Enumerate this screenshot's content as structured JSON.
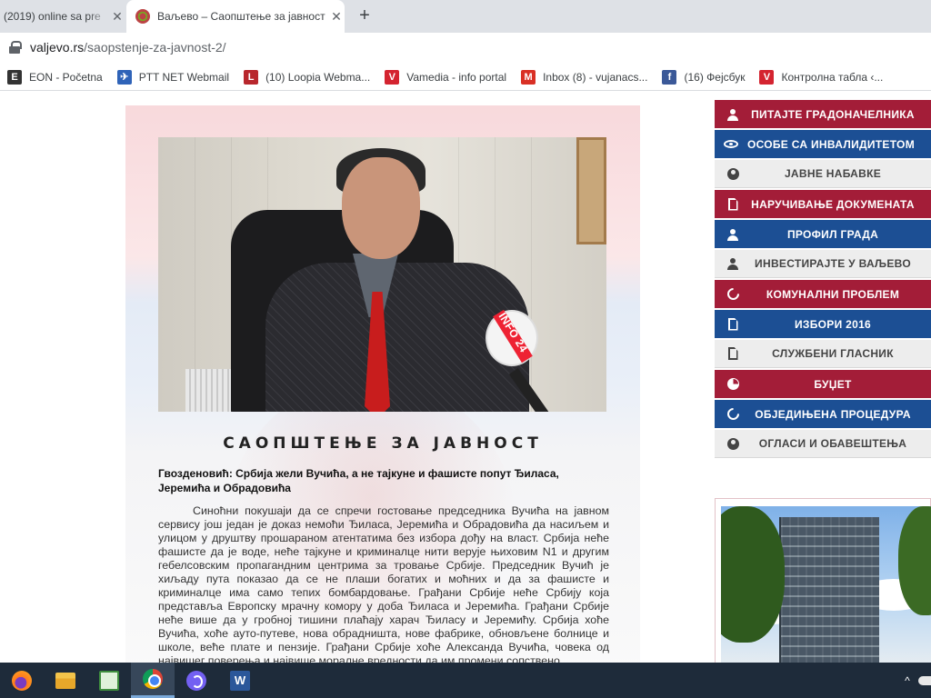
{
  "browser": {
    "tabs": [
      {
        "title": "(2019) online sa pre",
        "close": "✕",
        "active": false
      },
      {
        "title": "Ваљево – Саопштење за јавност",
        "close": "✕",
        "active": true
      }
    ],
    "new_tab": "+",
    "url_host": "valjevo.rs",
    "url_path": "/saopstenje-za-javnost-2/",
    "bookmarks": [
      {
        "label": "EON - Početna",
        "icon": "eon-icon",
        "color": "#333333"
      },
      {
        "label": "PTT NET Webmail",
        "icon": "ptt-icon",
        "color": "#2f63b8"
      },
      {
        "label": "(10) Loopia Webma...",
        "icon": "loopia-icon",
        "color": "#b8272d"
      },
      {
        "label": "Vamedia - info portal",
        "icon": "vamedia-icon",
        "color": "#d42430"
      },
      {
        "label": "Inbox (8) - vujanacs...",
        "icon": "gmail-icon",
        "color": "#d93025"
      },
      {
        "label": "(16) Фејсбук",
        "icon": "facebook-icon",
        "color": "#3b5998"
      },
      {
        "label": "Контролна табла ‹...",
        "icon": "vamedia-icon",
        "color": "#d42430"
      }
    ]
  },
  "article": {
    "title": "САОПШТЕЊЕ ЗА ЈАВНОСТ",
    "subtitle": "Гвозденовић: Србија жели Вучића, а не тајкуне и фашисте попут Ђиласа, Јеремића и Обрадовића",
    "body": "Синоћни покушаји да се спречи гостовање председника Вучића на јавном сервису још један је доказ немоћи Ђиласа, Јеремића и Обрадовића да насиљем и улицом у друштву прошараном атентатима без избора дођу на власт. Србија неће фашисте да је воде, неће тајкуне и криминалце нити верује њиховим N1 и другим гебелсовским пропагандним центрима за тровање Србије. Председник Вучић је хиљаду пута показао да се не плаши богатих и моћних и да за фашисте и криминалце има само тепих бомбардовање. Грађани Србије неће Србију која представља Европску мрачну комору у доба Ђиласа и Јеремића. Грађани Србије неће више да у гробној тишини плаћају харач Ђиласу и Јеремићу. Србија хоће Вучића, хоће ауто-путеве, нова обрадништа, нове фабрике, обновљене болнице и школе, веће плате и пензије. Грађани Србије хоће Александа Вучића, човека од највишег поверења и највише моралне вредности да им промени сопствено"
  },
  "sidebar": {
    "buttons": [
      {
        "label": "ПИТАЈТЕ ГРАДОНАЧЕЛНИКА",
        "style": "red",
        "icon": "person-icon"
      },
      {
        "label": "ОСОБЕ СА ИНВАЛИДИТЕТОМ",
        "style": "blue",
        "icon": "eye-icon"
      },
      {
        "label": "ЈАВНЕ НАБАВКЕ",
        "style": "grey",
        "icon": "globe-icon"
      },
      {
        "label": "НАРУЧИВАЊЕ ДОКУМЕНАТА",
        "style": "red",
        "icon": "document-icon"
      },
      {
        "label": "ПРОФИЛ ГРАДА",
        "style": "blue",
        "icon": "person-icon"
      },
      {
        "label": "ИНВЕСТИРАЈТЕ У ВАЉЕВО",
        "style": "grey",
        "icon": "person-icon"
      },
      {
        "label": "КОМУНАЛНИ ПРОБЛЕМ",
        "style": "red",
        "icon": "refresh-icon"
      },
      {
        "label": "ИЗБОРИ 2016",
        "style": "blue",
        "icon": "document-icon"
      },
      {
        "label": "СЛУЖБЕНИ ГЛАСНИК",
        "style": "grey",
        "icon": "document-icon"
      },
      {
        "label": "БУЏЕТ",
        "style": "red",
        "icon": "pie-chart-icon"
      },
      {
        "label": "ОБЈЕДИЊЕНА ПРОЦЕДУРА",
        "style": "blue",
        "icon": "refresh-icon"
      },
      {
        "label": "ОГЛАСИ И ОБАВЕШТЕЊА",
        "style": "grey",
        "icon": "globe-icon"
      }
    ]
  },
  "photo_mic_label": "INFO 24",
  "taskbar": {
    "apps": [
      "firefox-icon",
      "file-explorer-icon",
      "notepad-icon",
      "chrome-icon",
      "viber-icon",
      "word-icon"
    ],
    "word_letter": "W",
    "tray_chevron": "^",
    "active_app": "chrome-icon"
  },
  "colors": {
    "red": "#a31d38",
    "blue": "#1c4f94",
    "grey": "#ededed",
    "taskbar": "#1e2b3a"
  }
}
